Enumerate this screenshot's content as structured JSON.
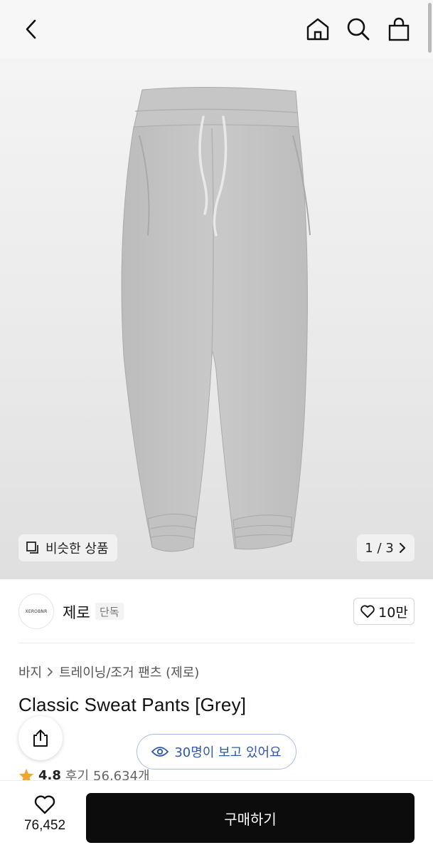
{
  "header": {
    "icons": [
      "chevron-left-icon",
      "home-icon",
      "search-icon",
      "shopping-bag-icon"
    ]
  },
  "gallery": {
    "similar_label": "비슷한 상품",
    "pagination": "1 / 3"
  },
  "brand": {
    "logo_text": "XEROBNR",
    "name": "제로",
    "tag": "단독",
    "likes": "10만"
  },
  "product": {
    "breadcrumb": [
      "바지",
      "트레이닝/조거 팬츠 (제로)"
    ],
    "title": "Classic Sweat Pants [Grey]",
    "viewers": "30명이 보고 있어요",
    "rating": "4.8",
    "reviews_label": "후기",
    "reviews_count": "56,634개"
  },
  "bottom_bar": {
    "wish_count": "76,452",
    "buy_label": "구매하기"
  },
  "colors": {
    "star": "#f0a432",
    "viewer_accent": "#2f56b0",
    "buy_button": "#0c0c0c"
  }
}
